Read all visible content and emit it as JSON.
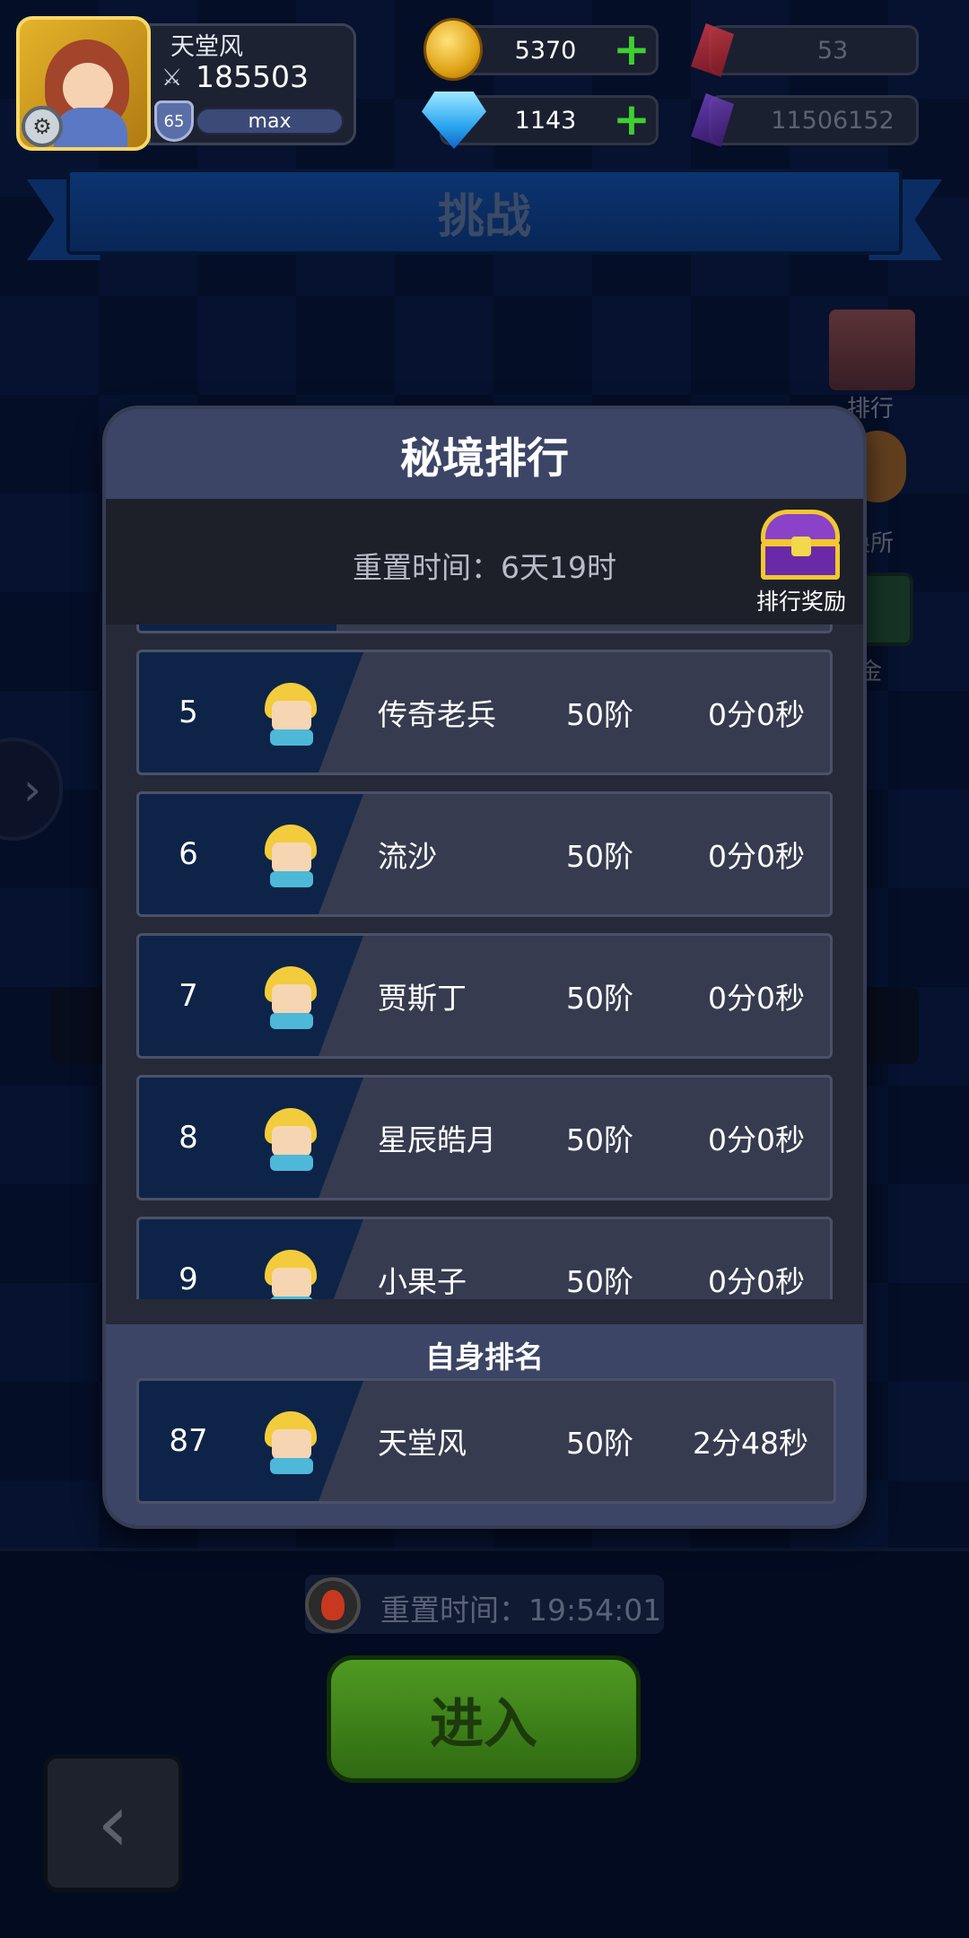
{
  "player": {
    "name": "天堂风",
    "power": "185503",
    "level": "65",
    "exp_label": "max"
  },
  "resources": {
    "gold": "5370",
    "diamond": "1143",
    "red_crystal": "53",
    "purple_crystal": "11506152"
  },
  "page_title": "挑战",
  "side_menu": {
    "rank_label": "排行",
    "shop_label": "换所",
    "gold_label": "金"
  },
  "ranking_modal": {
    "title": "秘境排行",
    "reset_time": "重置时间：6天19时",
    "reward_label": "排行奖励",
    "rows": [
      {
        "rank": "5",
        "name": "传奇老兵",
        "level": "50阶",
        "time": "0分0秒"
      },
      {
        "rank": "6",
        "name": "流沙",
        "level": "50阶",
        "time": "0分0秒"
      },
      {
        "rank": "7",
        "name": "贾斯丁",
        "level": "50阶",
        "time": "0分0秒"
      },
      {
        "rank": "8",
        "name": "星辰皓月",
        "level": "50阶",
        "time": "0分0秒"
      },
      {
        "rank": "9",
        "name": "小果子",
        "level": "50阶",
        "time": "0分0秒"
      }
    ],
    "self_title": "自身排名",
    "self_row": {
      "rank": "87",
      "name": "天堂风",
      "level": "50阶",
      "time": "2分48秒"
    }
  },
  "bottom": {
    "reset_timer": "重置时间：19:54:01",
    "enter_label": "进入"
  },
  "icons": {
    "plus": "+",
    "back": "‹",
    "expand": "›",
    "gear": "⚙"
  },
  "colors": {
    "plus_green": "#3ed02f",
    "modal_header": "#3c4566",
    "rank_band": "#0d2448"
  }
}
